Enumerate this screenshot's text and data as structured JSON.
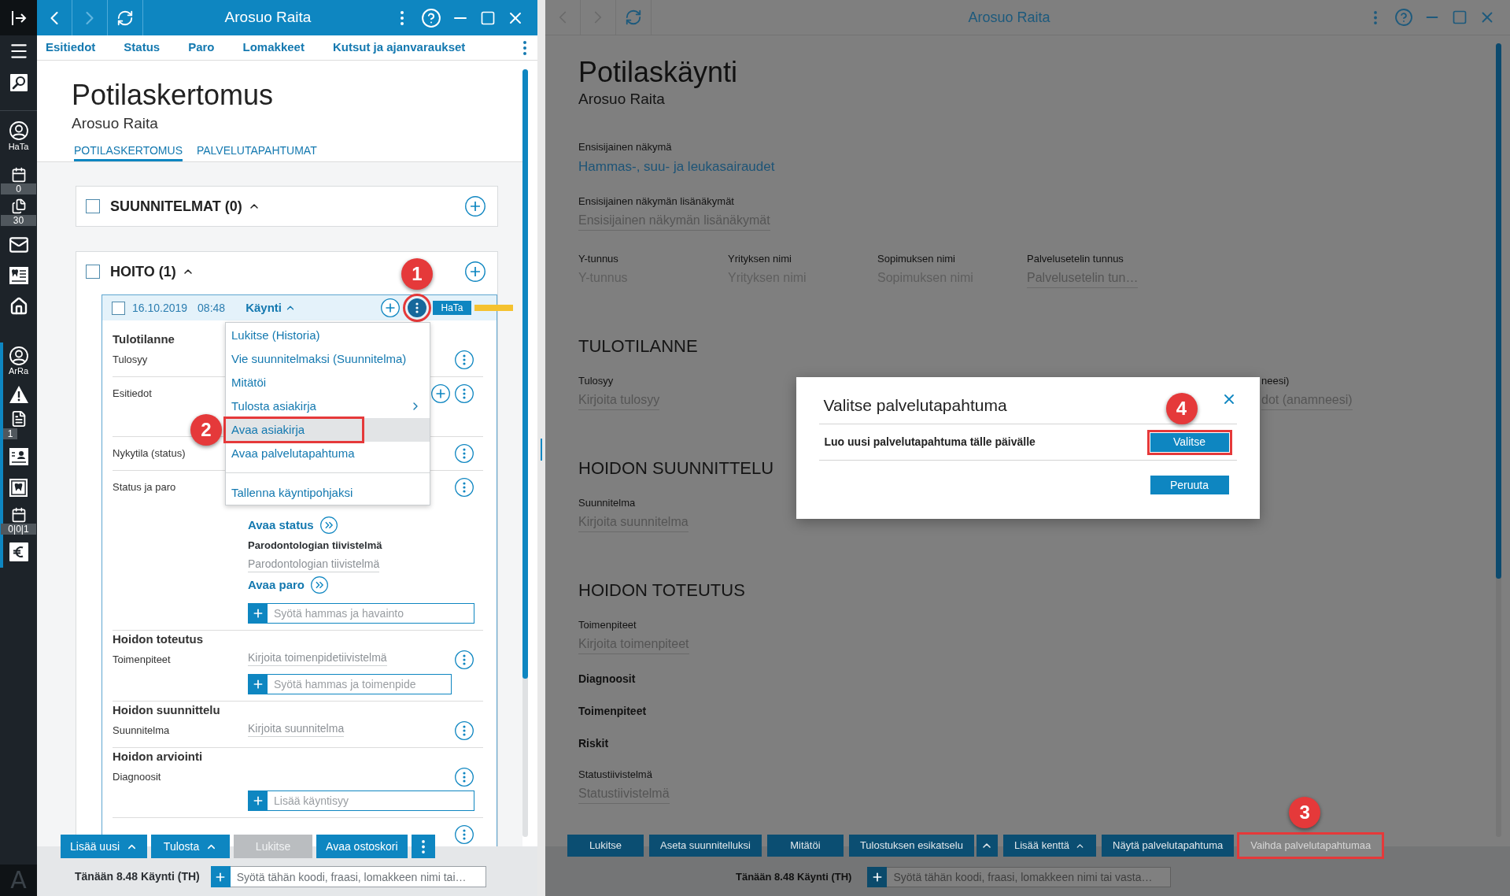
{
  "sidebar": {
    "user_label": "HaTa",
    "counters": [
      "0",
      "30"
    ],
    "patient_label": "ArRa",
    "patient_counters": [
      "1",
      "0|0|1"
    ],
    "logo": "A"
  },
  "left_window": {
    "title": "Arosuo Raita",
    "back_disabled": false,
    "forward_disabled": true,
    "nav": [
      "Esitiedot",
      "Status",
      "Paro",
      "Lomakkeet",
      "Kutsut ja ajanvaraukset"
    ],
    "heading": "Potilaskertomus",
    "patient": "Arosuo Raita",
    "tabs": [
      {
        "label": "POTILASKERTOMUS",
        "selected": true
      },
      {
        "label": "PALVELUTAPAHTUMAT",
        "selected": false
      }
    ],
    "sections": [
      {
        "title": "SUUNNITELMAT (0)",
        "checked": false,
        "expanded": true
      },
      {
        "title": "HOITO (1)",
        "checked": false,
        "expanded": true,
        "visit": {
          "date": "16.10.2019",
          "time": "08:48",
          "type": "Käynti",
          "checked": false,
          "expanded": true,
          "badge": "HaTa",
          "menu_button": {
            "outlined": true,
            "callout": "1"
          },
          "menu": [
            [
              {
                "label": "Lukitse (Historia)",
                "selected": false,
                "submenu": false,
                "outlined": false
              },
              {
                "label": "Vie suunnitelmaksi (Suunnitelma)",
                "selected": false,
                "submenu": false,
                "outlined": false
              },
              {
                "label": "Mitätöi",
                "selected": false,
                "submenu": false,
                "outlined": false
              },
              {
                "label": "Tulosta asiakirja",
                "selected": false,
                "submenu": true,
                "outlined": false
              },
              {
                "label": "Avaa asiakirja",
                "selected": true,
                "submenu": false,
                "outlined": true,
                "callout": "2"
              },
              {
                "label": "Avaa palvelutapahtuma",
                "selected": false,
                "submenu": false,
                "outlined": false
              }
            ],
            [
              {
                "label": "Tallenna käyntipohjaksi",
                "selected": false,
                "submenu": false,
                "outlined": false
              }
            ]
          ],
          "blocks": [
            {
              "heading": "Tulotilanne",
              "label": "Tulosyy",
              "kind": "inline",
              "add": false,
              "more": true
            },
            {
              "label": "Esitiedot",
              "kind": "inline",
              "add": true,
              "more": true
            },
            {
              "label": "Nykytila (status)",
              "kind": "inline",
              "add": false,
              "more": true
            },
            {
              "label": "Status ja paro",
              "kind": "stacked",
              "add": false,
              "more": true,
              "content": [
                {
                  "kind": "action",
                  "text": "Avaa status"
                },
                {
                  "kind": "title",
                  "text": "Parodontologian tiivistelmä"
                },
                {
                  "kind": "field",
                  "placeholder": "Parodontologian tiivistelmä"
                },
                {
                  "kind": "action",
                  "text": "Avaa paro"
                },
                {
                  "kind": "input",
                  "placeholder": "Syötä hammas ja havainto",
                  "compact": false
                }
              ]
            },
            {
              "heading": "Hoidon toteutus",
              "label": "Toimenpiteet",
              "kind": "inline",
              "add": false,
              "more": true,
              "content": [
                {
                  "kind": "field",
                  "placeholder": "Kirjoita toimenpidetiivistelmä"
                },
                {
                  "kind": "input",
                  "placeholder": "Syötä hammas ja toimenpide",
                  "compact": true
                }
              ]
            },
            {
              "heading": "Hoidon suunnittelu",
              "label": "Suunnitelma",
              "kind": "inline",
              "add": false,
              "more": true,
              "content": [
                {
                  "kind": "field",
                  "placeholder": "Kirjoita suunnitelma"
                }
              ]
            },
            {
              "heading": "Hoidon arviointi",
              "label": "Diagnoosit",
              "kind": "stacked",
              "add": false,
              "more": true,
              "content": [
                {
                  "kind": "input",
                  "placeholder": "Lisää käyntisyy",
                  "compact": false
                }
              ]
            },
            {
              "kind": "inline",
              "add": false,
              "more": true
            }
          ]
        }
      }
    ],
    "buttons": [
      {
        "label": "Lisää uusi",
        "kind": "dropdown",
        "disabled": false
      },
      {
        "label": "Tulosta",
        "kind": "dropdown",
        "disabled": false
      },
      {
        "label": "Lukitse",
        "kind": "plain",
        "disabled": true
      },
      {
        "label": "Avaa ostoskori",
        "kind": "plain",
        "disabled": false
      },
      {
        "kind": "more",
        "disabled": false
      }
    ],
    "footer": {
      "status": "Tänään 8.48 Käynti (TH)",
      "placeholder": "Syötä tähän koodi, fraasi, lomakkeen nimi tai…"
    }
  },
  "right_window": {
    "title": "Arosuo Raita",
    "back_disabled": true,
    "forward_disabled": true,
    "heading": "Potilaskäynti",
    "patient": "Arosuo Raita",
    "views": [
      {
        "label": "Ensisijainen näkymä",
        "value": "Hammas-, suu- ja leukasairaudet"
      },
      {
        "label": "Ensisijainen näkymän lisänäkymät",
        "placeholder": "Ensisijainen näkymän lisänäkymät"
      }
    ],
    "id_fields": [
      {
        "label": "Y-tunnus",
        "placeholder": "Y-tunnus",
        "kind": "plain"
      },
      {
        "label": "Yrityksen nimi",
        "placeholder": "Yrityksen nimi",
        "kind": "plain"
      },
      {
        "label": "Sopimuksen nimi",
        "placeholder": "Sopimuksen nimi",
        "kind": "plain"
      },
      {
        "label": "Palvelusetelin tunnus",
        "placeholder": "Palvelusetelin tun…",
        "kind": "underlined"
      }
    ],
    "sections": [
      {
        "title": "TULOTILANNE",
        "rows": [
          [
            {
              "kind": "field",
              "label": "Tulosyy",
              "placeholder": "Kirjoita tulosyy"
            },
            {
              "kind": "field",
              "label": "neesi)",
              "placeholder": "dot (anamneesi)"
            }
          ]
        ]
      },
      {
        "title": "HOIDON SUUNNITTELU",
        "rows": [
          [
            {
              "kind": "field",
              "label": "Suunnitelma",
              "placeholder": "Kirjoita suunnitelma"
            }
          ]
        ]
      },
      {
        "title": "HOIDON TOTEUTUS",
        "rows": [
          [
            {
              "kind": "field",
              "label": "Toimenpiteet",
              "placeholder": "Kirjoita toimenpiteet"
            }
          ],
          [
            {
              "kind": "subheading",
              "text": "Diagnoosit"
            }
          ],
          [
            {
              "kind": "subheading",
              "text": "Toimenpiteet"
            }
          ],
          [
            {
              "kind": "subheading",
              "text": "Riskit"
            }
          ],
          [
            {
              "kind": "field",
              "label": "Statustiivistelmä",
              "placeholder": "Statustiivistelmä"
            }
          ]
        ]
      }
    ],
    "buttons": [
      {
        "label": "Lukitse",
        "kind": "plain",
        "disabled": false,
        "outlined": false
      },
      {
        "label": "Aseta suunnitelluksi",
        "kind": "plain",
        "disabled": false,
        "outlined": false
      },
      {
        "label": "Mitätöi",
        "kind": "plain",
        "disabled": false,
        "outlined": false
      },
      {
        "label": "Tulostuksen esikatselu",
        "kind": "split",
        "disabled": false,
        "outlined": false
      },
      {
        "label": "Lisää kenttä",
        "kind": "dropdown",
        "disabled": false,
        "outlined": false
      },
      {
        "label": "Näytä palvelutapahtuma",
        "kind": "plain",
        "disabled": false,
        "outlined": false
      },
      {
        "label": "Vaihda palvelutapahtumaa",
        "kind": "plain",
        "disabled": true,
        "outlined": true,
        "callout": "3"
      }
    ],
    "footer": {
      "status": "Tänään 8.48 Käynti (TH)",
      "placeholder": "Syötä tähän koodi, fraasi, lomakkeen nimi tai vasta…"
    },
    "dialog": {
      "title": "Valitse palvelutapahtuma",
      "options": [
        {
          "label": "Luo uusi palvelutapahtuma tälle päivälle",
          "button": "Valitse",
          "outlined": true,
          "callout": "4"
        }
      ],
      "cancel": "Peruuta"
    }
  }
}
